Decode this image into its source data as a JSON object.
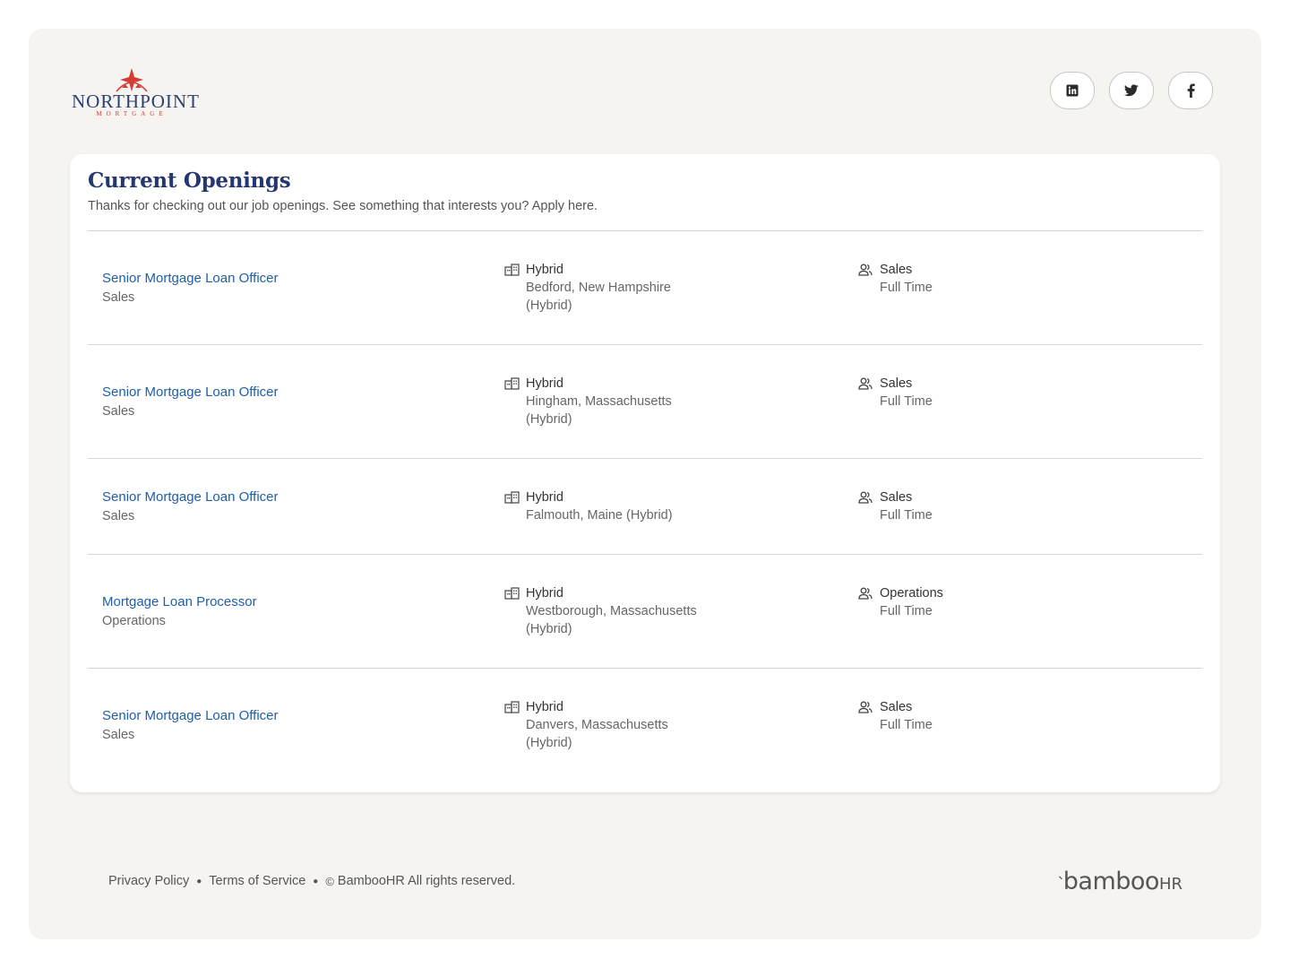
{
  "brand": {
    "name": "NORTHPOINT",
    "tagline": "MORTGAGE",
    "primary_color": "#263670",
    "accent_color": "#d83a34"
  },
  "social": [
    {
      "name": "linkedin-icon",
      "label": "in"
    },
    {
      "name": "twitter-icon",
      "label": "twitter"
    },
    {
      "name": "facebook-icon",
      "label": "f"
    }
  ],
  "page": {
    "title": "Current Openings",
    "subtitle": "Thanks for checking out our job openings. See something that interests you? Apply here."
  },
  "jobs": [
    {
      "title": "Senior Mortgage Loan Officer",
      "department": "Sales",
      "work_mode": "Hybrid",
      "location": "Bedford, New Hampshire (Hybrid)",
      "team": "Sales",
      "type": "Full Time"
    },
    {
      "title": "Senior Mortgage Loan Officer",
      "department": "Sales",
      "work_mode": "Hybrid",
      "location": "Hingham, Massachusetts (Hybrid)",
      "team": "Sales",
      "type": "Full Time"
    },
    {
      "title": "Senior Mortgage Loan Officer",
      "department": "Sales",
      "work_mode": "Hybrid",
      "location": "Falmouth, Maine (Hybrid)",
      "team": "Sales",
      "type": "Full Time"
    },
    {
      "title": "Mortgage Loan Processor",
      "department": "Operations",
      "work_mode": "Hybrid",
      "location": "Westborough, Massachusetts (Hybrid)",
      "team": "Operations",
      "type": "Full Time"
    },
    {
      "title": "Senior Mortgage Loan Officer",
      "department": "Sales",
      "work_mode": "Hybrid",
      "location": "Danvers, Massachusetts (Hybrid)",
      "team": "Sales",
      "type": "Full Time"
    }
  ],
  "footer": {
    "privacy": "Privacy Policy",
    "terms": "Terms of Service",
    "copyright": "BambooHR All rights reserved.",
    "powered_by": "bamboo",
    "powered_by_suffix": "HR"
  },
  "colors": {
    "link": "#1f5fa8",
    "background": "#f5f4f1"
  }
}
